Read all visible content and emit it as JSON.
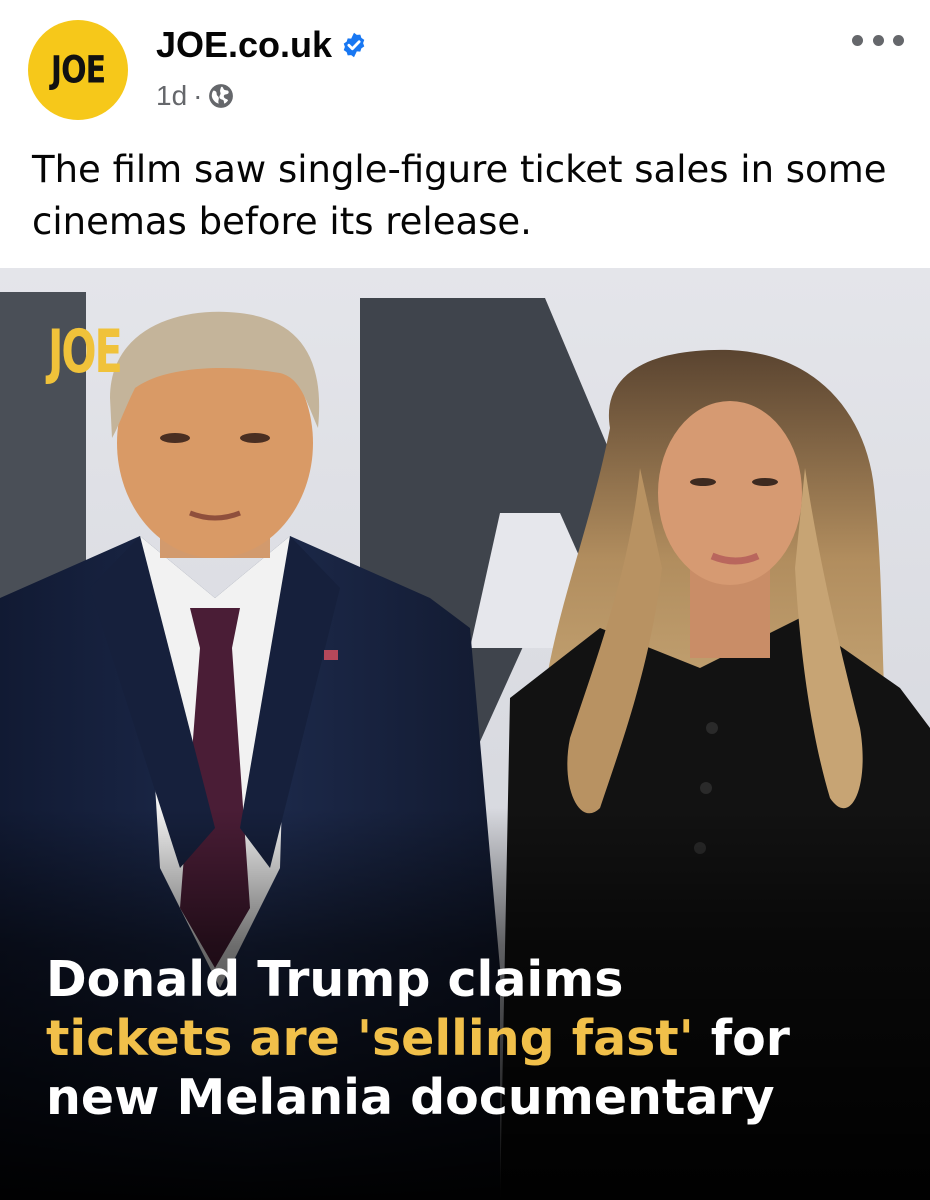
{
  "post": {
    "avatar_text": "JOE",
    "page_name": "JOE.co.uk",
    "timestamp": "1d",
    "separator": "·",
    "verified_icon": "verified-badge-icon",
    "privacy_icon": "globe-icon",
    "more_icon": "more-options-icon",
    "caption": "The film saw single-figure ticket sales in some cinemas before its release."
  },
  "image": {
    "watermark": "JOE",
    "headline_line1": "Donald Trump claims",
    "headline_highlight": "tickets are 'selling fast'",
    "headline_after_highlight": " for",
    "headline_line3": "new Melania documentary",
    "highlight_color": "#f1c04a"
  },
  "colors": {
    "avatar_bg": "#f6c81a",
    "verified_blue": "#1877f2",
    "secondary_text": "#65676b"
  }
}
